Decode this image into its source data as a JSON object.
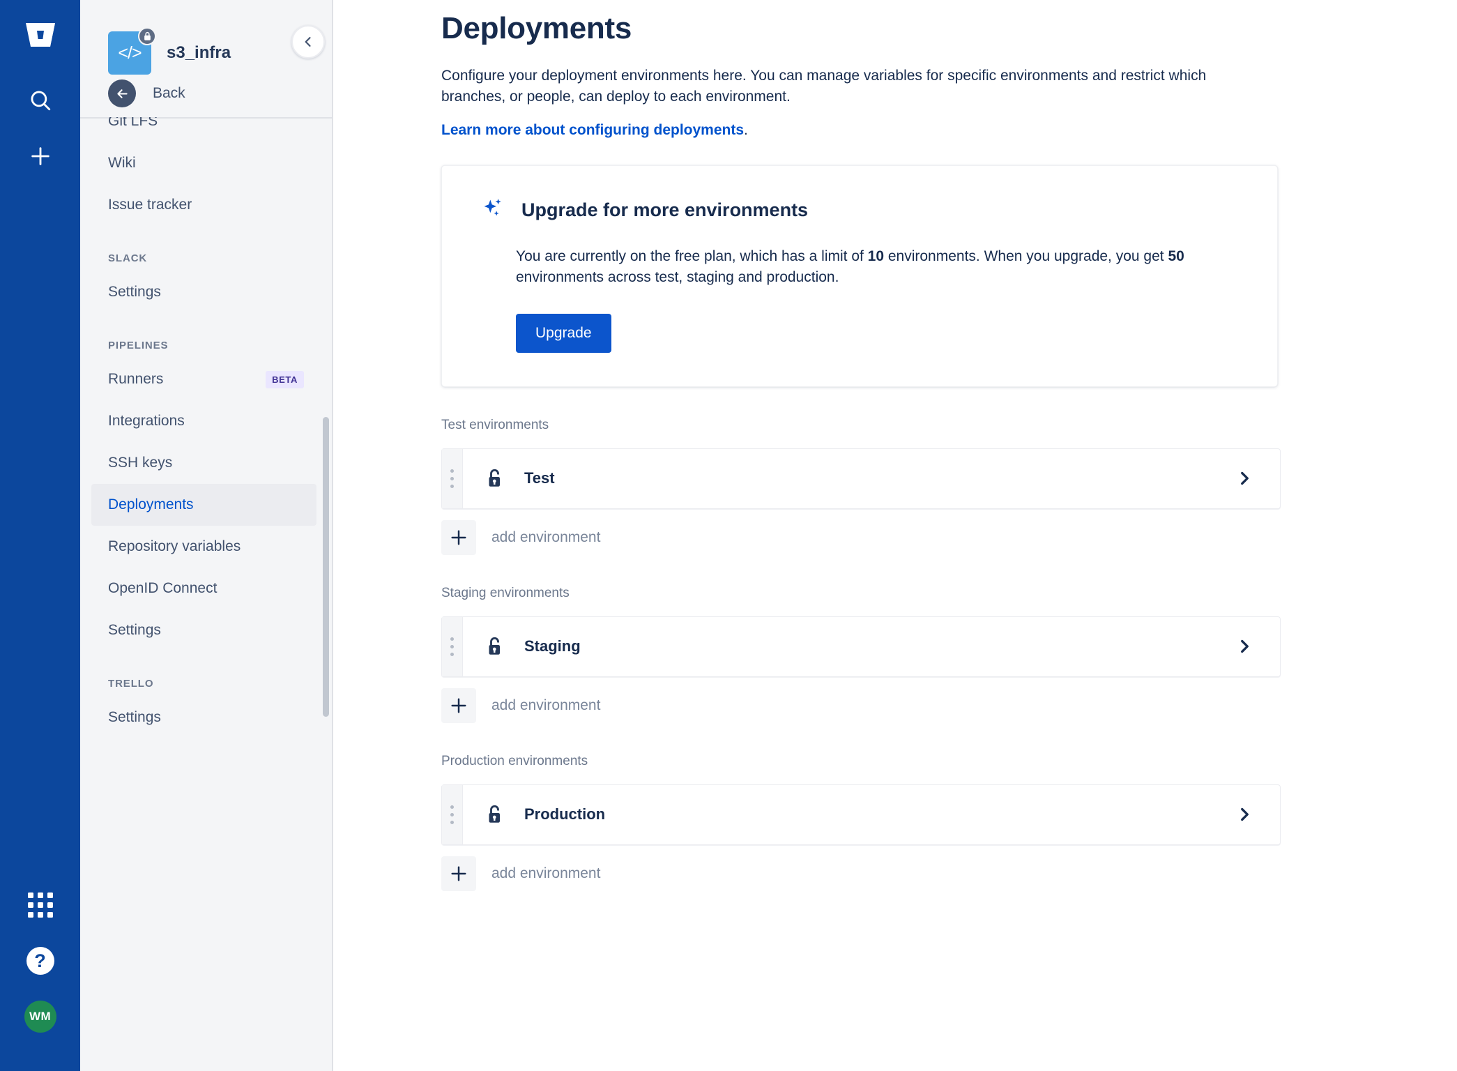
{
  "rail": {
    "logo_icon": "bitbucket-logo",
    "search_icon": "search-icon",
    "create_icon": "plus-icon",
    "apps_icon": "app-switcher-grid-icon",
    "help_icon": "help-question-icon",
    "avatar_initials": "WM"
  },
  "sidebar": {
    "repo_name": "s3_infra",
    "repo_icon": "code-brackets-icon",
    "lock_icon": "lock-icon",
    "back_label": "Back",
    "back_icon": "arrow-left-icon",
    "collapse_icon": "chevron-left-icon",
    "items": [
      {
        "label": "Git LFS",
        "type": "link",
        "clipped": true
      },
      {
        "label": "Wiki",
        "type": "link"
      },
      {
        "label": "Issue tracker",
        "type": "link"
      },
      {
        "label": "SLACK",
        "type": "section"
      },
      {
        "label": "Settings",
        "type": "link"
      },
      {
        "label": "PIPELINES",
        "type": "section"
      },
      {
        "label": "Runners",
        "type": "link",
        "badge": "BETA"
      },
      {
        "label": "Integrations",
        "type": "link"
      },
      {
        "label": "SSH keys",
        "type": "link"
      },
      {
        "label": "Deployments",
        "type": "link",
        "selected": true
      },
      {
        "label": "Repository variables",
        "type": "link"
      },
      {
        "label": "OpenID Connect",
        "type": "link"
      },
      {
        "label": "Settings",
        "type": "link"
      },
      {
        "label": "TRELLO",
        "type": "section"
      },
      {
        "label": "Settings",
        "type": "link"
      }
    ]
  },
  "main": {
    "title": "Deployments",
    "description": "Configure your deployment environments here. You can manage variables for specific environments and restrict which branches, or people, can deploy to each environment.",
    "learn_more_link": "Learn more about configuring deployments",
    "learn_more_period": ".",
    "upgrade": {
      "icon": "sparkle-premium-icon",
      "title": "Upgrade for more environments",
      "body_part1": "You are currently on the free plan, which has a limit of ",
      "limit_free": "10",
      "body_part2": " environments. When you upgrade, you get ",
      "limit_paid": "50",
      "body_part3": " environments across test, staging and production.",
      "button_label": "Upgrade"
    },
    "groups": [
      {
        "label": "Test environments",
        "environments": [
          {
            "name": "Test",
            "lock_icon": "unlocked-padlock-icon",
            "chevron_icon": "chevron-right-icon",
            "drag_icon": "drag-handle-icon"
          }
        ],
        "add_label": "add environment",
        "add_icon": "plus-icon"
      },
      {
        "label": "Staging environments",
        "environments": [
          {
            "name": "Staging",
            "lock_icon": "unlocked-padlock-icon",
            "chevron_icon": "chevron-right-icon",
            "drag_icon": "drag-handle-icon"
          }
        ],
        "add_label": "add environment",
        "add_icon": "plus-icon"
      },
      {
        "label": "Production environments",
        "environments": [
          {
            "name": "Production",
            "lock_icon": "unlocked-padlock-icon",
            "chevron_icon": "chevron-right-icon",
            "drag_icon": "drag-handle-icon"
          }
        ],
        "add_label": "add environment",
        "add_icon": "plus-icon"
      }
    ]
  },
  "colors": {
    "rail_blue": "#0C479D",
    "link_blue": "#0052CC",
    "button_blue": "#0C55CC",
    "sidebar_bg": "#F4F5F7",
    "text_dark": "#172B4D",
    "text_muted": "#6B778C",
    "badge_bg": "#EAE6FF",
    "badge_text": "#403294",
    "avatar_green": "#1F8B53",
    "repo_avatar_blue": "#4BA3E3"
  }
}
